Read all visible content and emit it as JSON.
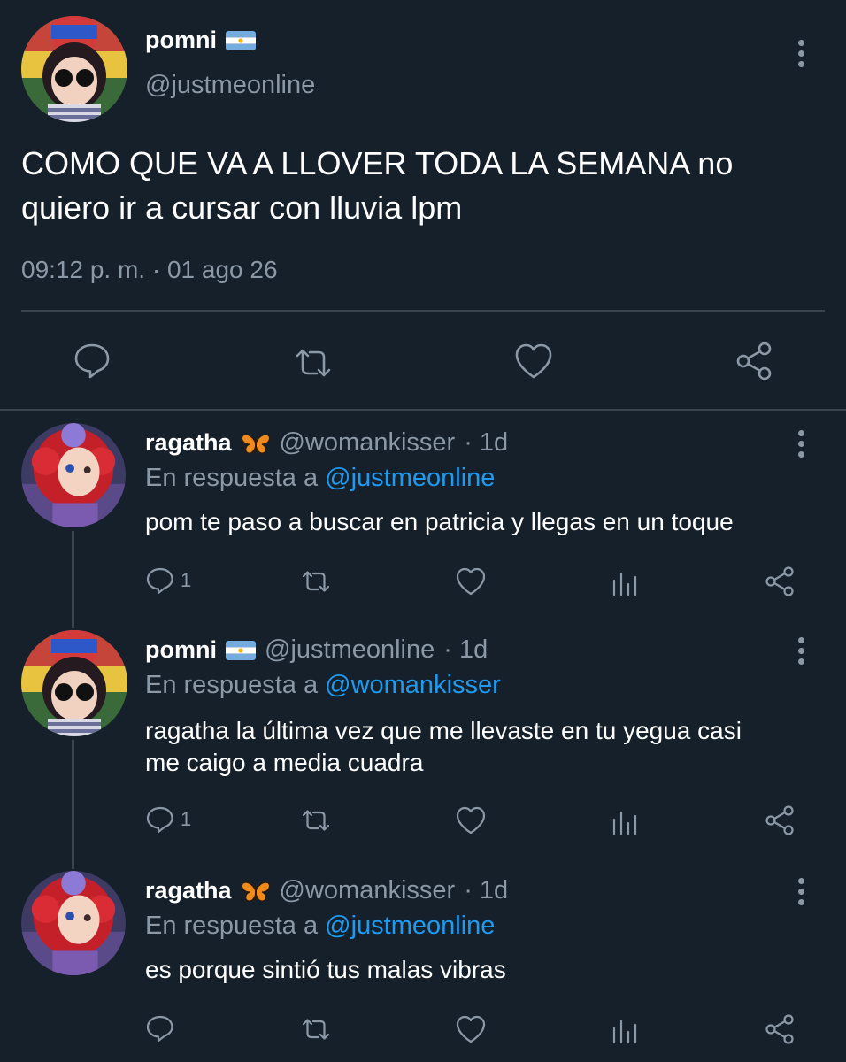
{
  "main_tweet": {
    "display_name": "pomni",
    "handle": "@justmeonline",
    "text_line1": "COMO QUE VA A LLOVER TODA LA SEMANA no",
    "text_line2": "quiero ir a cursar con lluvia lpm",
    "timestamp": "09:12 p. m. · 01 ago 26",
    "actions": [
      "reply-icon",
      "retweet-icon",
      "like-icon",
      "share-icon"
    ]
  },
  "replies": [
    {
      "display_name": "ragatha",
      "handle": "@womankisser",
      "time": "· 1d",
      "reply_prefix": "En respuesta a",
      "reply_to": "@justmeonline",
      "text_line1": "pom te paso a buscar en patricia y llegas en un toque",
      "text_line2": "",
      "reply_count": "1"
    },
    {
      "display_name": "pomni",
      "handle": "@justmeonline",
      "time": "· 1d",
      "reply_prefix": "En respuesta a",
      "reply_to": "@womankisser",
      "text_line1": "ragatha la última vez que me llevaste en tu yegua casi",
      "text_line2": "me caigo a media cuadra",
      "reply_count": "1"
    },
    {
      "display_name": "ragatha",
      "handle": "@womankisser",
      "time": "· 1d",
      "reply_prefix": "En respuesta a",
      "reply_to": "@justmeonline",
      "text_line1": "es porque sintió tus malas vibras",
      "text_line2": "",
      "reply_count": ""
    }
  ],
  "colors": {
    "background": "#15202b",
    "muted": "#8b98a5",
    "link": "#1d9bf0",
    "divider": "#38444d"
  }
}
